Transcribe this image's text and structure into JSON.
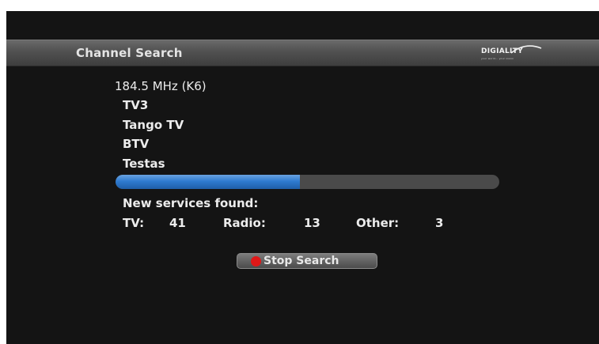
{
  "header": {
    "title": "Channel Search",
    "logo_text": "DIGIALITY",
    "logo_tagline": "your world... your vision"
  },
  "scan": {
    "frequency": "184.5 MHz (K6)",
    "channels": [
      "TV3",
      "Tango TV",
      "BTV",
      "Testas"
    ],
    "progress": 0.48
  },
  "summary": {
    "heading": "New services found:",
    "tv_label": "TV:",
    "tv_count": "41",
    "radio_label": "Radio:",
    "radio_count": "13",
    "other_label": "Other:",
    "other_count": "3"
  },
  "actions": {
    "stop_label": "Stop Search",
    "stop_color": "#e01818"
  },
  "colors": {
    "background": "#141414",
    "progress_fill": "#2f7bd0",
    "progress_track": "#4a4a4a"
  }
}
